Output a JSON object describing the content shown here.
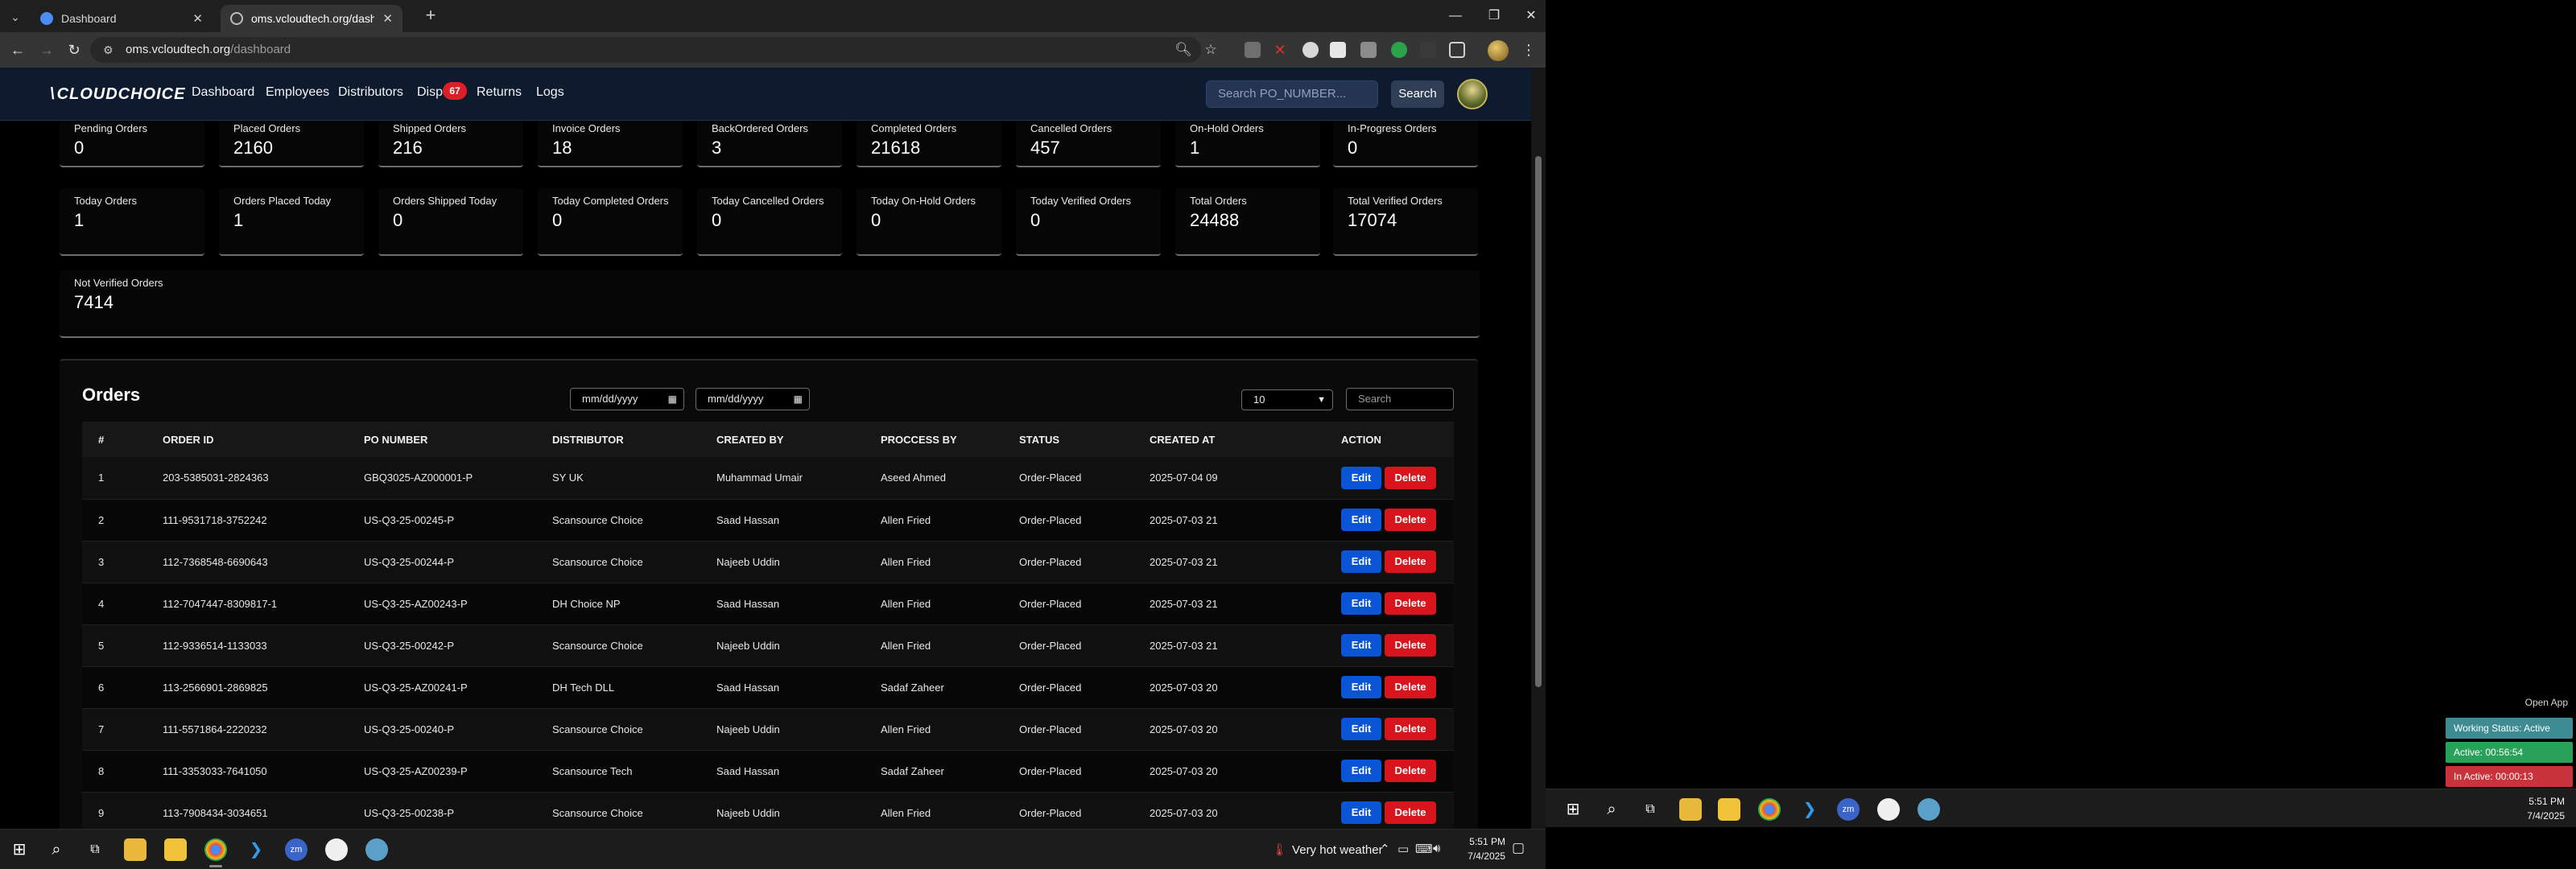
{
  "browser": {
    "tabs": [
      {
        "title": "Dashboard",
        "active": false
      },
      {
        "title": "oms.vcloudtech.org/dashboard",
        "active": true
      }
    ],
    "url_host": "oms.vcloudtech.org",
    "url_path": "/dashboard"
  },
  "app": {
    "logo_text": "CLOUDCHOICE",
    "nav": [
      "Dashboard",
      "Employees",
      "Distributors",
      "Dispu",
      "Returns",
      "Logs"
    ],
    "dispute_badge": "67",
    "search_placeholder": "Search PO_NUMBER...",
    "search_button": "Search"
  },
  "stats_row1": [
    {
      "label": "Pending Orders",
      "value": "0"
    },
    {
      "label": "Placed Orders",
      "value": "2160"
    },
    {
      "label": "Shipped Orders",
      "value": "216"
    },
    {
      "label": "Invoice Orders",
      "value": "18"
    },
    {
      "label": "BackOrdered Orders",
      "value": "3"
    },
    {
      "label": "Completed Orders",
      "value": "21618"
    },
    {
      "label": "Cancelled Orders",
      "value": "457"
    },
    {
      "label": "On-Hold Orders",
      "value": "1"
    },
    {
      "label": "In-Progress Orders",
      "value": "0"
    }
  ],
  "stats_row2": [
    {
      "label": "Today Orders",
      "value": "1"
    },
    {
      "label": "Orders Placed Today",
      "value": "1"
    },
    {
      "label": "Orders Shipped Today",
      "value": "0"
    },
    {
      "label": "Today Completed Orders",
      "value": "0"
    },
    {
      "label": "Today Cancelled Orders",
      "value": "0"
    },
    {
      "label": "Today On-Hold Orders",
      "value": "0"
    },
    {
      "label": "Today Verified Orders",
      "value": "0"
    },
    {
      "label": "Total Orders",
      "value": "24488"
    },
    {
      "label": "Total Verified Orders",
      "value": "17074"
    }
  ],
  "stats_row3": {
    "label": "Not Verified Orders",
    "value": "7414"
  },
  "orders": {
    "title": "Orders",
    "date_from_placeholder": "mm/dd/yyyy",
    "date_to_placeholder": "mm/dd/yyyy",
    "page_size": "10",
    "search_placeholder": "Search",
    "columns": [
      "#",
      "ORDER ID",
      "PO NUMBER",
      "DISTRIBUTOR",
      "CREATED BY",
      "PROCCESS BY",
      "STATUS",
      "CREATED AT",
      "ACTION"
    ],
    "edit_label": "Edit",
    "delete_label": "Delete",
    "rows": [
      [
        "1",
        "203-5385031-2824363",
        "GBQ3025-AZ000001-P",
        "SY UK",
        "Muhammad Umair",
        "Aseed Ahmed",
        "Order-Placed",
        "2025-07-04 09"
      ],
      [
        "2",
        "111-9531718-3752242",
        "US-Q3-25-00245-P",
        "Scansource Choice",
        "Saad Hassan",
        "Allen Fried",
        "Order-Placed",
        "2025-07-03 21"
      ],
      [
        "3",
        "112-7368548-6690643",
        "US-Q3-25-00244-P",
        "Scansource Choice",
        "Najeeb Uddin",
        "Allen Fried",
        "Order-Placed",
        "2025-07-03 21"
      ],
      [
        "4",
        "112-7047447-8309817-1",
        "US-Q3-25-AZ00243-P",
        "DH Choice NP",
        "Saad Hassan",
        "Allen Fried",
        "Order-Placed",
        "2025-07-03 21"
      ],
      [
        "5",
        "112-9336514-1133033",
        "US-Q3-25-00242-P",
        "Scansource Choice",
        "Najeeb Uddin",
        "Allen Fried",
        "Order-Placed",
        "2025-07-03 21"
      ],
      [
        "6",
        "113-2566901-2869825",
        "US-Q3-25-AZ00241-P",
        "DH Tech DLL",
        "Saad Hassan",
        "Sadaf Zaheer",
        "Order-Placed",
        "2025-07-03 20"
      ],
      [
        "7",
        "111-5571864-2220232",
        "US-Q3-25-00240-P",
        "Scansource Choice",
        "Najeeb Uddin",
        "Allen Fried",
        "Order-Placed",
        "2025-07-03 20"
      ],
      [
        "8",
        "111-3353033-7641050",
        "US-Q3-25-AZ00239-P",
        "Scansource Tech",
        "Saad Hassan",
        "Sadaf Zaheer",
        "Order-Placed",
        "2025-07-03 20"
      ],
      [
        "9",
        "113-7908434-3034651",
        "US-Q3-25-00238-P",
        "Scansource Choice",
        "Najeeb Uddin",
        "Allen Fried",
        "Order-Placed",
        "2025-07-03 20"
      ]
    ]
  },
  "taskbar": {
    "weather": "Very hot weather",
    "time": "5:51 PM",
    "date": "7/4/2025"
  },
  "tracker_widget": {
    "open_app": "Open App",
    "working_status": "Working Status: Active",
    "active": "Active: 00:56:54",
    "inactive": "In Active: 00:00:13",
    "colors": {
      "working": "#3d8c93",
      "active": "#2aa15a",
      "inactive": "#c9343c"
    }
  },
  "taskbar2": {
    "time": "5:51 PM",
    "date": "7/4/2025"
  },
  "colors": {
    "nav_bg": "#0e1a2d",
    "edit": "#0a54d6",
    "delete": "#d8141c",
    "badge": "#dc1f26"
  }
}
